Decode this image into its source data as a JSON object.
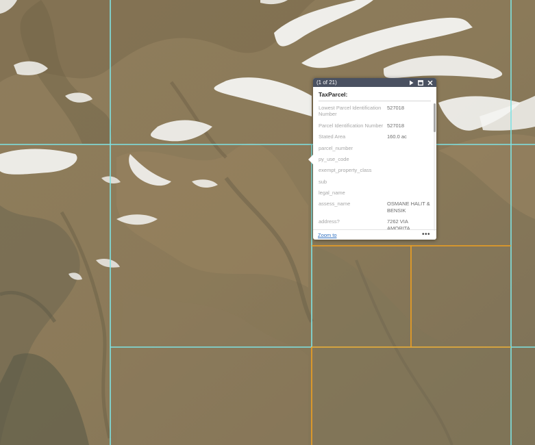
{
  "map": {
    "imagery": "satellite-terrain-with-snow",
    "parcel_line_color": "#7fe3e3",
    "selected_parcel_line_color": "#f0a020",
    "terrain_color": "#8a7a5c",
    "snow_color": "#f4f4f2"
  },
  "popup": {
    "counter": "(1 of 21)",
    "icons": {
      "play": "play-icon",
      "maximize": "maximize-icon",
      "close": "close-icon"
    },
    "title": "TaxParcel:",
    "attributes": [
      {
        "label": "Lowest Parcel Identification Number",
        "value": "527018"
      },
      {
        "label": "Parcel Identification Number",
        "value": "527018"
      },
      {
        "label": "Stated Area",
        "value": "160.0 ac"
      },
      {
        "label": "parcel_number",
        "value": ""
      },
      {
        "label": "py_use_code",
        "value": ""
      },
      {
        "label": "exempt_property_class",
        "value": ""
      },
      {
        "label": "sub",
        "value": ""
      },
      {
        "label": "legal_name",
        "value": ""
      },
      {
        "label": "assess_name",
        "value": "OSMANE HALIT & BENSIK"
      },
      {
        "label": "address?",
        "value": "7262 VIA AMORITA"
      }
    ],
    "zoom_label": "Zoom to",
    "more_label": "•••",
    "header_color": "#4a5161"
  }
}
